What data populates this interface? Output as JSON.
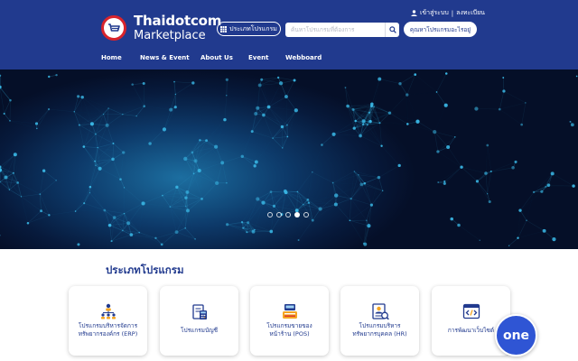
{
  "brand": {
    "line1": "Thaidotcom",
    "line2": "Marketplace"
  },
  "header": {
    "category_button": "ประเภทโปรแกรม",
    "search_placeholder": "ค้นหาโปรแกรมที่ต้องการ",
    "login": "เข้าสู่ระบบ",
    "separator": "|",
    "register": "ลงทะเบียน",
    "cta": "คุณหาโปรแกรมอะไรอยู่"
  },
  "nav": [
    {
      "label": "Home"
    },
    {
      "label": "News & Event"
    },
    {
      "label": "About Us"
    },
    {
      "label": "Event"
    },
    {
      "label": "Webboard"
    }
  ],
  "carousel": {
    "slide_count": 5,
    "active_index": 3
  },
  "section": {
    "title": "ประเภทโปรแกรม"
  },
  "cards": [
    {
      "line1": "โปรแกรมบริหารจัดการ",
      "line2": "ทรัพยากรองค์กร (ERP)",
      "icon": "org-chart-icon"
    },
    {
      "line1": "โปรแกรมบัญชี",
      "line2": "",
      "icon": "accounting-icon"
    },
    {
      "line1": "โปรแกรมขายของ",
      "line2": "หน้าร้าน (POS)",
      "icon": "pos-register-icon"
    },
    {
      "line1": "โปรแกรมบริหาร",
      "line2": "ทรัพยากรบุคคล (HR)",
      "icon": "hr-profile-icon"
    },
    {
      "line1": "การพัฒนาเว็บไซต์",
      "line2": "",
      "icon": "code-window-icon"
    }
  ],
  "chat_badge": {
    "label": "one"
  },
  "colors": {
    "primary": "#213a8e",
    "accent": "#d9242c",
    "hero_glow": "#3ab8e6"
  }
}
